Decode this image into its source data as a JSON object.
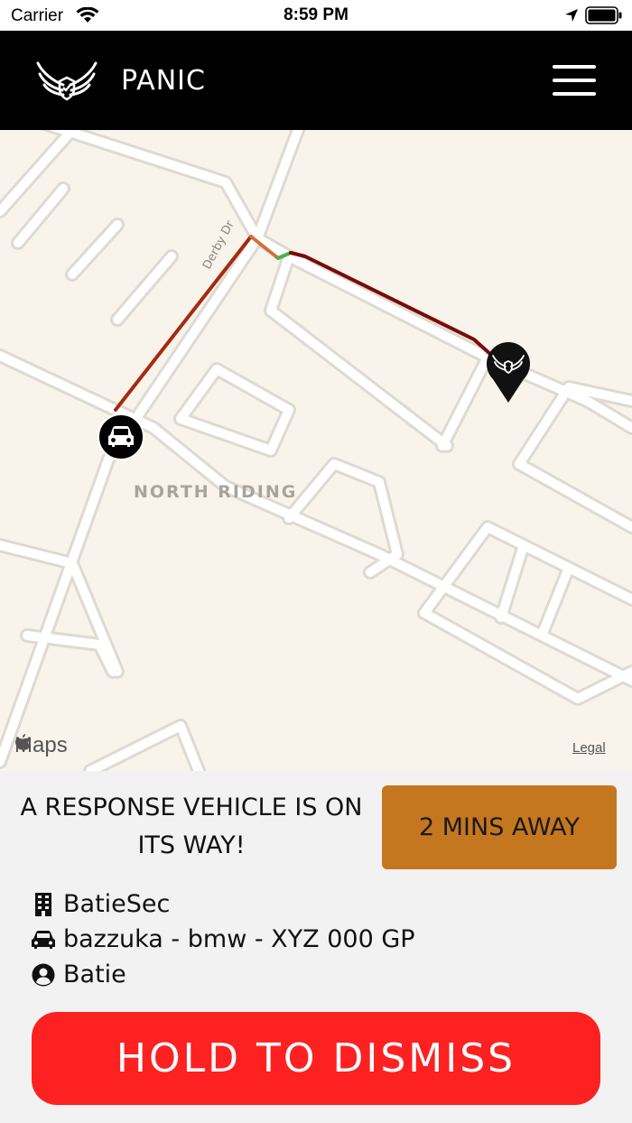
{
  "status_bar": {
    "carrier": "Carrier",
    "time": "8:59 PM",
    "icons": [
      "wifi-icon",
      "location-arrow-icon",
      "battery-icon"
    ]
  },
  "header": {
    "title": "PANIC",
    "logo_icon": "winged-shield-logo",
    "menu_icon": "hamburger-menu-icon"
  },
  "map": {
    "area_label": "NORTH RIDING",
    "street_label": "Derby Dr",
    "attribution": "Maps",
    "legal_label": "Legal",
    "vehicle_marker_icon": "car-icon",
    "destination_marker_icon": "winged-shield-pin-icon",
    "route_colors": [
      "#7a0a0a",
      "#a52a12",
      "#d2703a",
      "#4caf50"
    ]
  },
  "panel": {
    "message": "A RESPONSE VEHICLE IS ON ITS WAY!",
    "eta": "2 MINS AWAY",
    "company": "BatieSec",
    "vehicle": "bazzuka - bmw - XYZ 000 GP",
    "driver": "Batie",
    "dismiss_label": "HOLD TO DISMISS"
  },
  "colors": {
    "header_bg": "#000000",
    "eta_bg": "#c57720",
    "dismiss_bg": "#fd2121",
    "map_bg": "#f8f4ec"
  }
}
